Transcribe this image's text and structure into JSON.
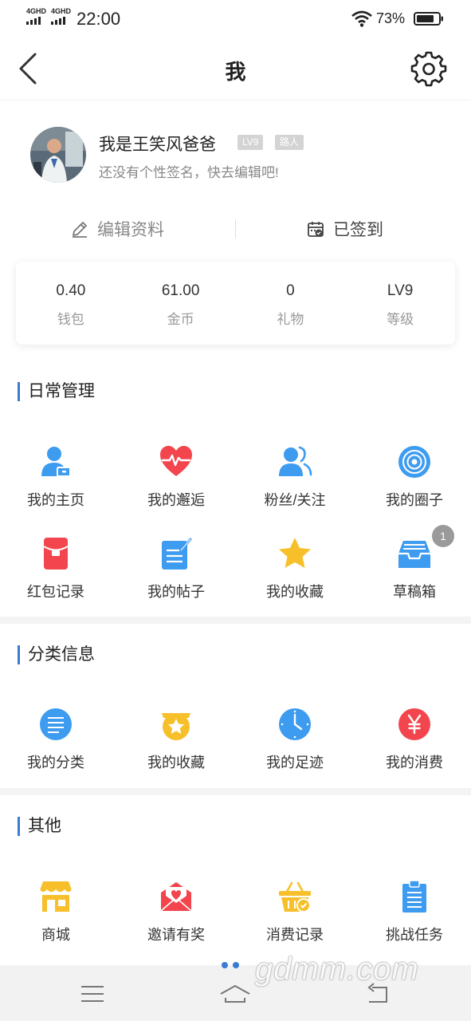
{
  "status_bar": {
    "signal1": "4GHD",
    "signal2": "4GHD",
    "time": "22:00",
    "battery": "73%"
  },
  "header": {
    "title": "我"
  },
  "profile": {
    "name": "我是王笑风爸爸",
    "level_badge": "LV9",
    "title_badge": "路人",
    "bio": "还没有个性签名，快去编辑吧!"
  },
  "actions": {
    "edit_label": "编辑资料",
    "sign_label": "已签到"
  },
  "stats": [
    {
      "value": "0.40",
      "label": "钱包"
    },
    {
      "value": "61.00",
      "label": "金币"
    },
    {
      "value": "0",
      "label": "礼物"
    },
    {
      "value": "LV9",
      "label": "等级"
    }
  ],
  "daily": {
    "title": "日常管理",
    "items": [
      {
        "label": "我的主页",
        "icon": "user-home-icon"
      },
      {
        "label": "我的邂逅",
        "icon": "heartbeat-icon"
      },
      {
        "label": "粉丝/关注",
        "icon": "fans-icon"
      },
      {
        "label": "我的圈子",
        "icon": "circle-target-icon"
      },
      {
        "label": "红包记录",
        "icon": "red-packet-icon"
      },
      {
        "label": "我的帖子",
        "icon": "post-edit-icon"
      },
      {
        "label": "我的收藏",
        "icon": "star-icon"
      },
      {
        "label": "草稿箱",
        "icon": "draft-box-icon",
        "badge": "1"
      }
    ]
  },
  "category": {
    "title": "分类信息",
    "items": [
      {
        "label": "我的分类",
        "icon": "list-icon"
      },
      {
        "label": "我的收藏",
        "icon": "star-box-icon"
      },
      {
        "label": "我的足迹",
        "icon": "clock-icon"
      },
      {
        "label": "我的消费",
        "icon": "yen-icon"
      }
    ]
  },
  "other": {
    "title": "其他",
    "items": [
      {
        "label": "商城",
        "icon": "shop-icon"
      },
      {
        "label": "邀请有奖",
        "icon": "invite-mail-icon"
      },
      {
        "label": "消费记录",
        "icon": "basket-icon"
      },
      {
        "label": "挑战任务",
        "icon": "clipboard-icon"
      }
    ]
  },
  "watermark": "gdmm.com",
  "colors": {
    "accent": "#3a7bd5",
    "blue_icon": "#3d9bf0",
    "red_icon": "#f2454d",
    "yellow_icon": "#f7c02a",
    "badge_gray": "#d4d4d4"
  }
}
